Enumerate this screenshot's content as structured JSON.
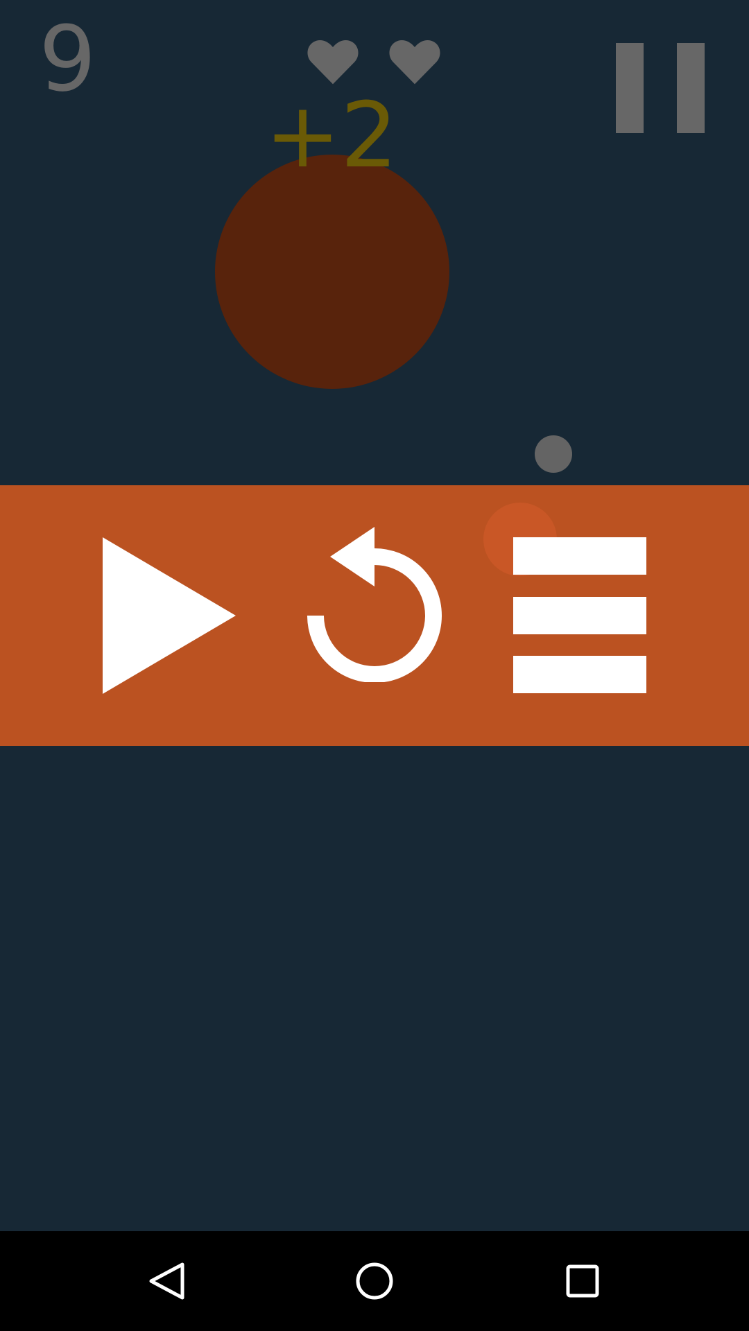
{
  "hud": {
    "score": "9",
    "lives": 2,
    "bonus": "+2"
  },
  "icons": {
    "hearts": [
      "heart-icon",
      "heart-icon"
    ],
    "pause": "pause-icon",
    "play": "play-icon",
    "restart": "restart-icon",
    "menu": "hamburger-menu-icon",
    "nav": [
      "back-icon",
      "home-icon",
      "recents-icon"
    ]
  },
  "colors": {
    "background": "#172835",
    "hud_gray": "#676767",
    "bonus_text": "#6a5a06",
    "big_ball": "#58230c",
    "small_ball": "#646464",
    "menu_band": "#bb5221",
    "icon_white": "#ffffff"
  }
}
